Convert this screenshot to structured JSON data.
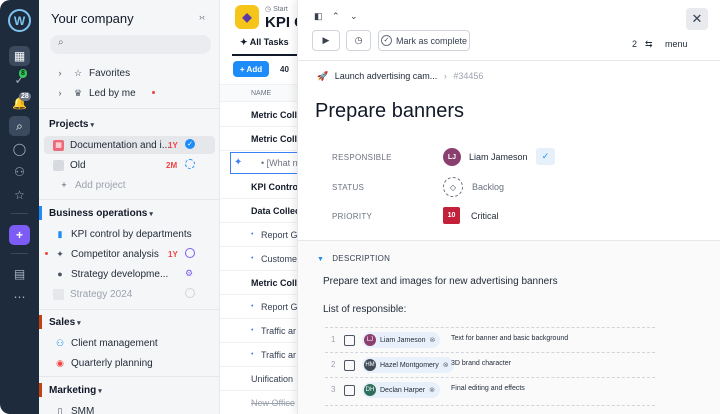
{
  "sidebar": {
    "company": "Your company",
    "favorites": "Favorites",
    "led_by_me": "Led by me",
    "projects_header": "Projects",
    "projects": [
      {
        "label": "Documentation and i...",
        "tag": "1Y",
        "tag_color": "#ef4444"
      },
      {
        "label": "Old",
        "tag": "2M",
        "tag_color": "#ef4444"
      },
      {
        "label": "Add project"
      }
    ],
    "business_header": "Business operations",
    "business": [
      {
        "label": "KPI control by departments"
      },
      {
        "label": "Competitor analysis",
        "tag": "1Y",
        "tag_color": "#ef4444"
      },
      {
        "label": "Strategy developme..."
      },
      {
        "label": "Strategy 2024"
      }
    ],
    "sales_header": "Sales",
    "sales": [
      {
        "label": "Client management"
      },
      {
        "label": "Quarterly planning"
      }
    ],
    "marketing_header": "Marketing",
    "marketing": [
      {
        "label": "SMM"
      }
    ]
  },
  "rail": {
    "badge_inbox": "8",
    "badge_notifications": "28"
  },
  "middle": {
    "start_label": "Start",
    "title": "KPI C",
    "tab_all": "All Tasks",
    "add_label": "Add",
    "count": "40",
    "col_name": "NAME",
    "new_task_placeholder": "[What ne",
    "rows": [
      {
        "text": "Metric Colle",
        "bold": true
      },
      {
        "text": "Metric Colle",
        "bold": true
      },
      {
        "text": "KPI Control",
        "bold": true
      },
      {
        "text": "Data Collec",
        "bold": true
      },
      {
        "text": "Report G",
        "bold": false
      },
      {
        "text": "Custome",
        "bold": false
      },
      {
        "text": "Metric Colle",
        "bold": true
      },
      {
        "text": "Report G",
        "bold": false
      },
      {
        "text": "Traffic ar",
        "bold": false
      },
      {
        "text": "Traffic ar",
        "bold": false
      },
      {
        "text": "Unification",
        "bold": false
      },
      {
        "text": "New Office",
        "bold": false,
        "strike": true
      }
    ]
  },
  "panel": {
    "mark_complete": "Mark as complete",
    "subtask_count": "2",
    "menu_label": "menu",
    "parent_task": "Launch advertising cam...",
    "task_id": "#34456",
    "title": "Prepare banners",
    "fields": {
      "responsible_label": "RESPONSIBLE",
      "responsible_value": "Liam Jameson",
      "status_label": "STATUS",
      "status_value": "Backlog",
      "priority_label": "PRIORITY",
      "priority_number": "10",
      "priority_value": "Critical"
    },
    "description_header": "DESCRIPTION",
    "description_text": "Prepare text and images for new advertising banners",
    "list_header": "List of responsible:",
    "list": [
      {
        "num": "1",
        "person": "Liam Jameson",
        "task": "Text for banner and basic background",
        "avatar_color": "#8b3f6e"
      },
      {
        "num": "2",
        "person": "Hazel Montgomery",
        "task": "3D brand character",
        "avatar_color": "#3f4a5a"
      },
      {
        "num": "3",
        "person": "Declan Harper",
        "task": "Final editing and effects",
        "avatar_color": "#2f6f5e"
      }
    ]
  },
  "colors": {
    "accent": "#1d8cf8",
    "rail": "#1e2b3c",
    "priority": "#c3213a"
  }
}
